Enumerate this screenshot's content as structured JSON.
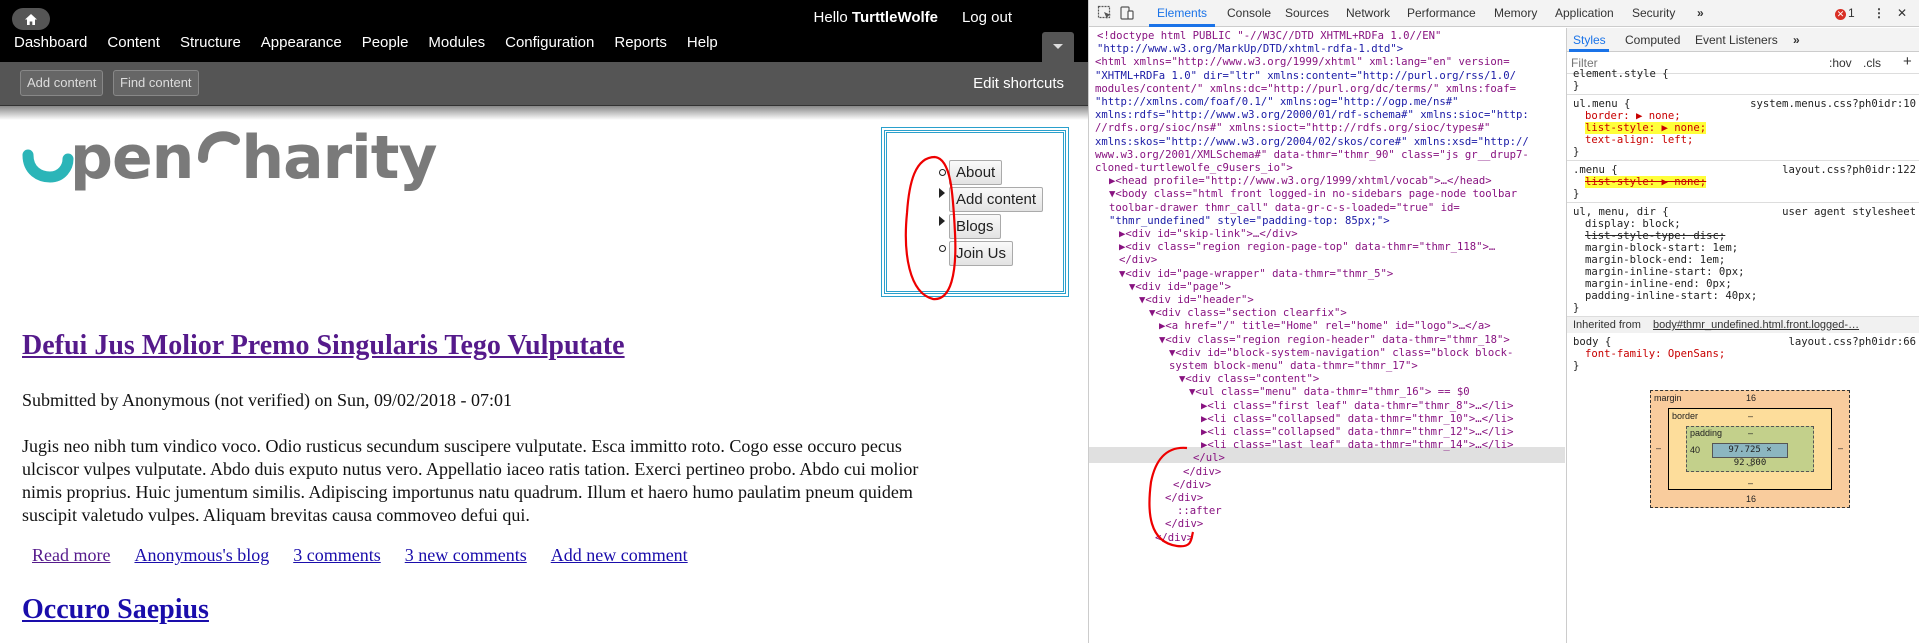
{
  "site": {
    "toolbar": {
      "hello_prefix": "Hello ",
      "username": "TurttleWolfe",
      "logout": "Log out",
      "menu": [
        "Dashboard",
        "Content",
        "Structure",
        "Appearance",
        "People",
        "Modules",
        "Configuration",
        "Reports",
        "Help"
      ]
    },
    "shortcuts": {
      "add_content": "Add content",
      "find_content": "Find content",
      "edit_shortcuts": "Edit shortcuts"
    },
    "logo": {
      "part1": "pen",
      "part2": "harity"
    },
    "nav_menu": [
      "About",
      "Add content",
      "Blogs",
      "Join Us"
    ],
    "article": {
      "title": "Defui Jus Molior Premo Singularis Tego Vulputate",
      "submitted": "Submitted by Anonymous (not verified) on Sun, 09/02/2018 - 07:01",
      "body_lines": [
        "Jugis neo nibh tum vindico voco. Odio rusticus secundum suscipere vulputate. Esca immitto roto. Cogo esse occuro pecus",
        "ulciscor vulpes vulputate. Abdo duis exputo nutus vero. Appellatio iaceo ratis tation. Exerci pertineo probo. Abdo cui molior",
        "nimis proprius. Huic jumentum similis. Adipiscing importunus natu quadrum. Illum et haero humo paulatim pneum quidem",
        "suscipit valetudo vulpes. Aliquam brevitas causa commoveo defui qui."
      ],
      "links": [
        "Read more",
        "Anonymous's blog",
        "3 comments",
        "3 new comments",
        "Add new comment"
      ]
    },
    "article2": {
      "title": "Occuro Saepius"
    }
  },
  "devtools": {
    "tabs": [
      "Elements",
      "Console",
      "Sources",
      "Network",
      "Performance",
      "Memory",
      "Application",
      "Security"
    ],
    "more_tabs": "»",
    "error_count": "1",
    "dom_lines": [
      "<!doctype html PUBLIC \"-//W3C//DTD XHTML+RDFa 1.0//EN\"",
      "\"http://www.w3.org/MarkUp/DTD/xhtml-rdfa-1.dtd\">",
      "<html xmlns=\"http://www.w3.org/1999/xhtml\" xml:lang=\"en\" version=",
      "\"XHTML+RDFa 1.0\" dir=\"ltr\" xmlns:content=\"http://purl.org/rss/1.0/",
      "modules/content/\" xmlns:dc=\"http://purl.org/dc/terms/\" xmlns:foaf=",
      "\"http://xmlns.com/foaf/0.1/\" xmlns:og=\"http://ogp.me/ns#\"",
      "xmlns:rdfs=\"http://www.w3.org/2000/01/rdf-schema#\" xmlns:sioc=\"http:",
      "//rdfs.org/sioc/ns#\" xmlns:sioct=\"http://rdfs.org/sioc/types#\"",
      "xmlns:skos=\"http://www.w3.org/2004/02/skos/core#\" xmlns:xsd=\"http://",
      "www.w3.org/2001/XMLSchema#\" data-thmr=\"thmr_90\" class=\"js gr__drup7-",
      "cloned-turtlewolfe_c9users_io\">",
      "▶<head profile=\"http://www.w3.org/1999/xhtml/vocab\">…</head>",
      "▼<body class=\"html front logged-in no-sidebars page-node toolbar",
      "toolbar-drawer thmr_call\" data-gr-c-s-loaded=\"true\" id=",
      "\"thmr_undefined\" style=\"padding-top: 85px;\">",
      "▶<div id=\"skip-link\">…</div>",
      "▶<div class=\"region region-page-top\" data-thmr=\"thmr_118\">…",
      "</div>",
      "▼<div id=\"page-wrapper\" data-thmr=\"thmr_5\">",
      "▼<div id=\"page\">",
      "▼<div id=\"header\">",
      "▼<div class=\"section clearfix\">",
      "▶<a href=\"/\" title=\"Home\" rel=\"home\" id=\"logo\">…</a>",
      "▼<div class=\"region region-header\" data-thmr=\"thmr_18\">",
      "▼<div id=\"block-system-navigation\" class=\"block block-",
      "system block-menu\" data-thmr=\"thmr_17\">",
      "▼<div class=\"content\">",
      "▼<ul class=\"menu\" data-thmr=\"thmr_16\"> == $0",
      "▶<li class=\"first leaf\" data-thmr=\"thmr_8\">…</li>",
      "▶<li class=\"collapsed\" data-thmr=\"thmr_10\">…</li>",
      "▶<li class=\"collapsed\" data-thmr=\"thmr_12\">…</li>",
      "▶<li class=\"last leaf\" data-thmr=\"thmr_14\">…</li>",
      "</ul>",
      "</div>",
      "</div>",
      "</div>",
      "::after",
      "</div>",
      "</div>"
    ],
    "styles_panel": {
      "tabs": [
        "Styles",
        "Computed",
        "Event Listeners",
        "»"
      ],
      "filter_placeholder": "Filter",
      "hov": ":hov",
      "cls": ".cls",
      "plus": "+",
      "rules": [
        {
          "selector": "element.style {",
          "source": ""
        },
        {
          "selector": "ul.menu {",
          "source": "system.menus.css?ph0idr:10",
          "props": [
            "border: ▶ none;",
            "list-style: ▶ none;",
            "text-align: left;"
          ]
        },
        {
          "selector": ".menu {",
          "source": "layout.css?ph0idr:122",
          "props": [
            "list-style: ▶ none;"
          ]
        },
        {
          "selector": "ul, menu, dir {",
          "source": "user agent stylesheet",
          "props": [
            "display: block;",
            "list-style-type: disc;",
            "margin-block-start: 1em;",
            "margin-block-end: 1em;",
            "margin-inline-start: 0px;",
            "margin-inline-end: 0px;",
            "padding-inline-start: 40px;"
          ]
        },
        {
          "selector": "body {",
          "source": "layout.css?ph0idr:66",
          "props": [
            "font-family: OpenSans;"
          ]
        }
      ],
      "inherited_label": "Inherited from",
      "inherited_from": "body#thmr_undefined.html.front.logged-…",
      "box_model": {
        "margin_label": "margin",
        "margin_top": "16",
        "margin_bottom": "16",
        "margin_left": "–",
        "margin_right": "–",
        "border_label": "border",
        "border_val": "–",
        "padding_label": "padding",
        "padding_left": "40",
        "padding_val": "–",
        "content": "97.725 × 92.800"
      }
    }
  }
}
